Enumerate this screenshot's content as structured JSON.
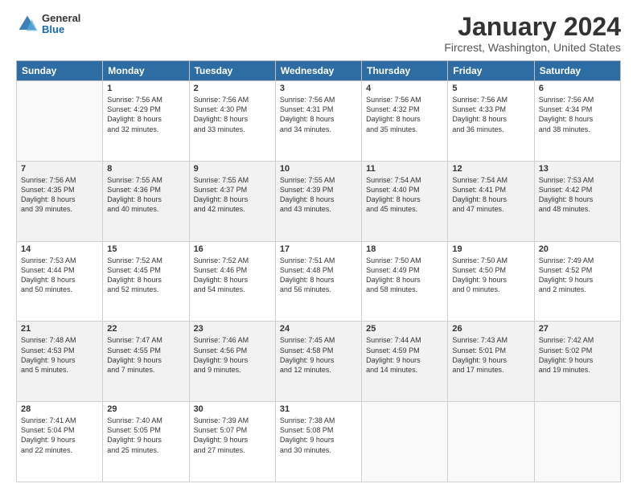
{
  "logo": {
    "general": "General",
    "blue": "Blue"
  },
  "title": "January 2024",
  "subtitle": "Fircrest, Washington, United States",
  "weekdays": [
    "Sunday",
    "Monday",
    "Tuesday",
    "Wednesday",
    "Thursday",
    "Friday",
    "Saturday"
  ],
  "weeks": [
    [
      {
        "day": "",
        "info": ""
      },
      {
        "day": "1",
        "info": "Sunrise: 7:56 AM\nSunset: 4:29 PM\nDaylight: 8 hours\nand 32 minutes."
      },
      {
        "day": "2",
        "info": "Sunrise: 7:56 AM\nSunset: 4:30 PM\nDaylight: 8 hours\nand 33 minutes."
      },
      {
        "day": "3",
        "info": "Sunrise: 7:56 AM\nSunset: 4:31 PM\nDaylight: 8 hours\nand 34 minutes."
      },
      {
        "day": "4",
        "info": "Sunrise: 7:56 AM\nSunset: 4:32 PM\nDaylight: 8 hours\nand 35 minutes."
      },
      {
        "day": "5",
        "info": "Sunrise: 7:56 AM\nSunset: 4:33 PM\nDaylight: 8 hours\nand 36 minutes."
      },
      {
        "day": "6",
        "info": "Sunrise: 7:56 AM\nSunset: 4:34 PM\nDaylight: 8 hours\nand 38 minutes."
      }
    ],
    [
      {
        "day": "7",
        "info": "Sunrise: 7:56 AM\nSunset: 4:35 PM\nDaylight: 8 hours\nand 39 minutes."
      },
      {
        "day": "8",
        "info": "Sunrise: 7:55 AM\nSunset: 4:36 PM\nDaylight: 8 hours\nand 40 minutes."
      },
      {
        "day": "9",
        "info": "Sunrise: 7:55 AM\nSunset: 4:37 PM\nDaylight: 8 hours\nand 42 minutes."
      },
      {
        "day": "10",
        "info": "Sunrise: 7:55 AM\nSunset: 4:39 PM\nDaylight: 8 hours\nand 43 minutes."
      },
      {
        "day": "11",
        "info": "Sunrise: 7:54 AM\nSunset: 4:40 PM\nDaylight: 8 hours\nand 45 minutes."
      },
      {
        "day": "12",
        "info": "Sunrise: 7:54 AM\nSunset: 4:41 PM\nDaylight: 8 hours\nand 47 minutes."
      },
      {
        "day": "13",
        "info": "Sunrise: 7:53 AM\nSunset: 4:42 PM\nDaylight: 8 hours\nand 48 minutes."
      }
    ],
    [
      {
        "day": "14",
        "info": "Sunrise: 7:53 AM\nSunset: 4:44 PM\nDaylight: 8 hours\nand 50 minutes."
      },
      {
        "day": "15",
        "info": "Sunrise: 7:52 AM\nSunset: 4:45 PM\nDaylight: 8 hours\nand 52 minutes."
      },
      {
        "day": "16",
        "info": "Sunrise: 7:52 AM\nSunset: 4:46 PM\nDaylight: 8 hours\nand 54 minutes."
      },
      {
        "day": "17",
        "info": "Sunrise: 7:51 AM\nSunset: 4:48 PM\nDaylight: 8 hours\nand 56 minutes."
      },
      {
        "day": "18",
        "info": "Sunrise: 7:50 AM\nSunset: 4:49 PM\nDaylight: 8 hours\nand 58 minutes."
      },
      {
        "day": "19",
        "info": "Sunrise: 7:50 AM\nSunset: 4:50 PM\nDaylight: 9 hours\nand 0 minutes."
      },
      {
        "day": "20",
        "info": "Sunrise: 7:49 AM\nSunset: 4:52 PM\nDaylight: 9 hours\nand 2 minutes."
      }
    ],
    [
      {
        "day": "21",
        "info": "Sunrise: 7:48 AM\nSunset: 4:53 PM\nDaylight: 9 hours\nand 5 minutes."
      },
      {
        "day": "22",
        "info": "Sunrise: 7:47 AM\nSunset: 4:55 PM\nDaylight: 9 hours\nand 7 minutes."
      },
      {
        "day": "23",
        "info": "Sunrise: 7:46 AM\nSunset: 4:56 PM\nDaylight: 9 hours\nand 9 minutes."
      },
      {
        "day": "24",
        "info": "Sunrise: 7:45 AM\nSunset: 4:58 PM\nDaylight: 9 hours\nand 12 minutes."
      },
      {
        "day": "25",
        "info": "Sunrise: 7:44 AM\nSunset: 4:59 PM\nDaylight: 9 hours\nand 14 minutes."
      },
      {
        "day": "26",
        "info": "Sunrise: 7:43 AM\nSunset: 5:01 PM\nDaylight: 9 hours\nand 17 minutes."
      },
      {
        "day": "27",
        "info": "Sunrise: 7:42 AM\nSunset: 5:02 PM\nDaylight: 9 hours\nand 19 minutes."
      }
    ],
    [
      {
        "day": "28",
        "info": "Sunrise: 7:41 AM\nSunset: 5:04 PM\nDaylight: 9 hours\nand 22 minutes."
      },
      {
        "day": "29",
        "info": "Sunrise: 7:40 AM\nSunset: 5:05 PM\nDaylight: 9 hours\nand 25 minutes."
      },
      {
        "day": "30",
        "info": "Sunrise: 7:39 AM\nSunset: 5:07 PM\nDaylight: 9 hours\nand 27 minutes."
      },
      {
        "day": "31",
        "info": "Sunrise: 7:38 AM\nSunset: 5:08 PM\nDaylight: 9 hours\nand 30 minutes."
      },
      {
        "day": "",
        "info": ""
      },
      {
        "day": "",
        "info": ""
      },
      {
        "day": "",
        "info": ""
      }
    ]
  ]
}
